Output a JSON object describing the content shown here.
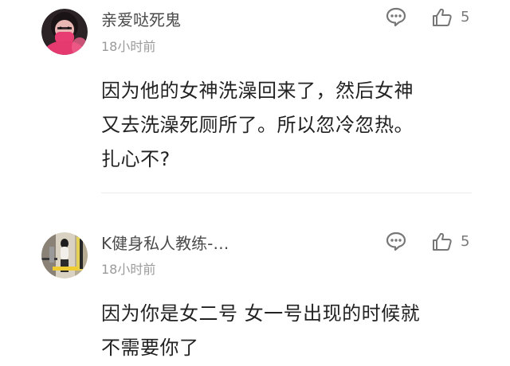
{
  "comments": [
    {
      "username": "亲爱哒死鬼",
      "time": "18小时前",
      "likes": "5",
      "content_lines": [
        "因为他的女神洗澡回来了，然后女神",
        "又去洗澡死厕所了。所以忽冷忽热。",
        "扎心不?"
      ],
      "avatar_icon": "avatar-masked-person",
      "reply_icon": "comment-bubble-icon",
      "like_icon": "thumbs-up-icon"
    },
    {
      "username": "K健身私人教练-…",
      "time": "18小时前",
      "likes": "5",
      "content_lines": [
        "因为你是女二号 女一号出现的时候就",
        "不需要你了"
      ],
      "avatar_icon": "avatar-fitness-photo",
      "reply_icon": "comment-bubble-icon",
      "like_icon": "thumbs-up-icon"
    }
  ],
  "colors": {
    "username": "#4a4a4a",
    "time": "#9b9b9b",
    "content": "#222222",
    "icon": "#777777",
    "divider": "#ebebeb"
  }
}
